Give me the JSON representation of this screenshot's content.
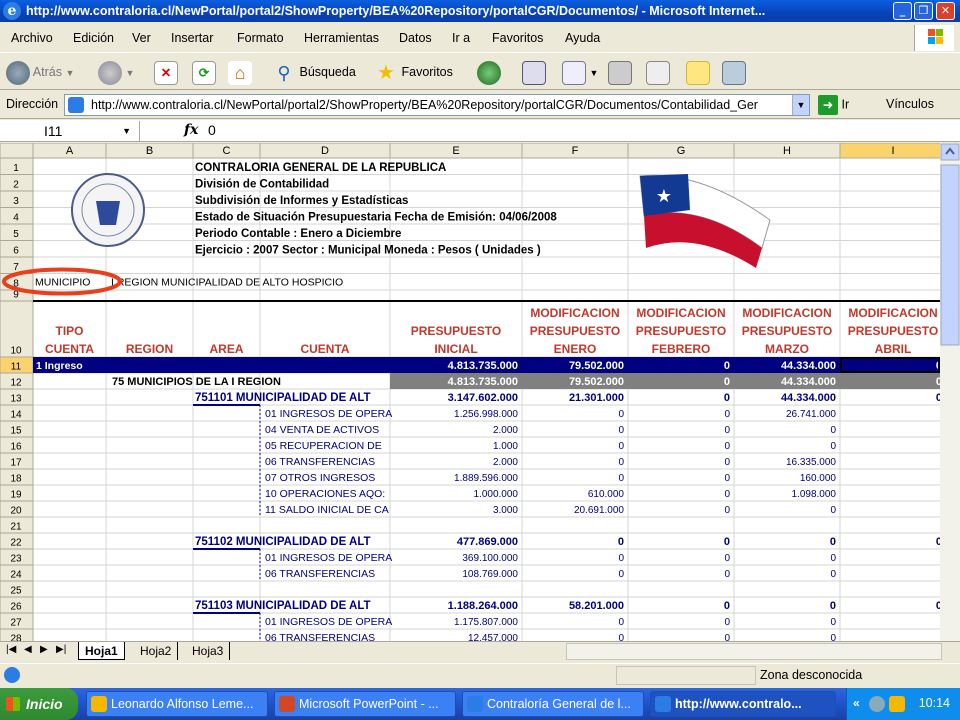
{
  "window": {
    "title": "http://www.contraloria.cl/NewPortal/portal2/ShowProperty/BEA%20Repository/portalCGR/Documentos/ - Microsoft Internet..."
  },
  "menu": [
    "Archivo",
    "Edición",
    "Ver",
    "Insertar",
    "Formato",
    "Herramientas",
    "Datos",
    "Ir a",
    "Favoritos",
    "Ayuda"
  ],
  "toolbar": {
    "back": "Atrás",
    "search": "Búsqueda",
    "favorites": "Favoritos"
  },
  "address": {
    "label": "Dirección",
    "url": "http://www.contraloria.cl/NewPortal/portal2/ShowProperty/BEA%20Repository/portalCGR/Documentos/Contabilidad_Ger",
    "go": "Ir",
    "links": "Vínculos"
  },
  "formula": {
    "cell": "I11",
    "fx": "fx",
    "value": "0"
  },
  "sheet": {
    "columns": [
      "A",
      "B",
      "C",
      "D",
      "E",
      "F",
      "G",
      "H",
      "I"
    ],
    "header_lines": [
      "CONTRALORIA GENERAL DE LA REPUBLICA",
      "División de Contabilidad",
      "Subdivisión de Informes y Estadísticas",
      "Estado de Situación Presupuestaria     Fecha de Emisión:  04/06/2008",
      "Periodo Contable : Enero a Diciembre",
      "Ejercicio : 2007    Sector : Municipal    Moneda : Pesos ( Unidades )"
    ],
    "row8": {
      "a": "MUNICIPIO",
      "b": "I REGION MUNICIPALIDAD DE ALTO HOSPICIO"
    },
    "col_headers": {
      "a": [
        "TIPO",
        "CUENTA"
      ],
      "b": [
        "REGION"
      ],
      "c": [
        "AREA"
      ],
      "d": [
        "CUENTA"
      ],
      "e": [
        "PRESUPUESTO",
        "INICIAL"
      ],
      "f": [
        "MODIFICACION",
        "PRESUPUESTO",
        "ENERO"
      ],
      "g": [
        "MODIFICACION",
        "PRESUPUESTO",
        "FEBRERO"
      ],
      "h": [
        "MODIFICACION",
        "PRESUPUESTO",
        "MARZO"
      ],
      "i": [
        "MODIFICACION",
        "PRESUPUESTO",
        "ABRIL"
      ]
    },
    "rows": [
      {
        "n": "11",
        "style": "navy",
        "a": "1 Ingreso",
        "e": "4.813.735.000",
        "f": "79.502.000",
        "g": "0",
        "h": "44.334.000",
        "i": "0"
      },
      {
        "n": "12",
        "style": "grey",
        "b": "75 MUNICIPIOS DE LA I REGION",
        "e": "4.813.735.000",
        "f": "79.502.000",
        "g": "0",
        "h": "44.334.000",
        "i": "0"
      },
      {
        "n": "13",
        "style": "bold",
        "c": "751101 MUNICIPALIDAD DE ALT",
        "e": "3.147.602.000",
        "f": "21.301.000",
        "g": "0",
        "h": "44.334.000",
        "i": "0"
      },
      {
        "n": "14",
        "d": "01 INGRESOS DE OPERA",
        "e": "1.256.998.000",
        "f": "0",
        "g": "0",
        "h": "26.741.000"
      },
      {
        "n": "15",
        "d": "04 VENTA DE ACTIVOS",
        "e": "2.000",
        "f": "0",
        "g": "0",
        "h": "0"
      },
      {
        "n": "16",
        "d": "05 RECUPERACION DE",
        "e": "1.000",
        "f": "0",
        "g": "0",
        "h": "0"
      },
      {
        "n": "17",
        "d": "06 TRANSFERENCIAS",
        "e": "2.000",
        "f": "0",
        "g": "0",
        "h": "16.335.000"
      },
      {
        "n": "18",
        "d": "07 OTROS INGRESOS",
        "e": "1.889.596.000",
        "f": "0",
        "g": "0",
        "h": "160.000"
      },
      {
        "n": "19",
        "d": "10 OPERACIONES AQO:",
        "e": "1.000.000",
        "f": "610.000",
        "g": "0",
        "h": "1.098.000"
      },
      {
        "n": "20",
        "d": "11 SALDO INICIAL DE CA",
        "e": "3.000",
        "f": "20.691.000",
        "g": "0",
        "h": "0"
      },
      {
        "n": "21"
      },
      {
        "n": "22",
        "style": "bold",
        "c": "751102 MUNICIPALIDAD DE ALT",
        "e": "477.869.000",
        "f": "0",
        "g": "0",
        "h": "0",
        "i": "0"
      },
      {
        "n": "23",
        "d": "01 INGRESOS DE OPERA",
        "e": "369.100.000",
        "f": "0",
        "g": "0",
        "h": "0"
      },
      {
        "n": "24",
        "d": "06 TRANSFERENCIAS",
        "e": "108.769.000",
        "f": "0",
        "g": "0",
        "h": "0"
      },
      {
        "n": "25"
      },
      {
        "n": "26",
        "style": "bold",
        "c": "751103 MUNICIPALIDAD DE ALT",
        "e": "1.188.264.000",
        "f": "58.201.000",
        "g": "0",
        "h": "0",
        "i": "0"
      },
      {
        "n": "27",
        "d": "01 INGRESOS DE OPERA",
        "e": "1.175.807.000",
        "f": "0",
        "g": "0",
        "h": "0"
      },
      {
        "n": "28",
        "d": "06 TRANSFERENCIAS",
        "e": "12.457.000",
        "f": "0",
        "g": "0",
        "h": "0"
      }
    ],
    "tabs": [
      "Hoja1",
      "Hoja2",
      "Hoja3"
    ]
  },
  "status": {
    "zone": "Zona desconocida"
  },
  "taskbar": {
    "start": "Inicio",
    "tasks": [
      "Leonardo Alfonso Leme...",
      "Microsoft PowerPoint - ...",
      "Contraloría General de l...",
      "http://www.contralo..."
    ],
    "clock": "10:14"
  },
  "colors": {
    "titlebar": "#0842b8",
    "navy_row": "#000080",
    "grey_row": "#808080",
    "highlight_circle": "#e8401c"
  }
}
